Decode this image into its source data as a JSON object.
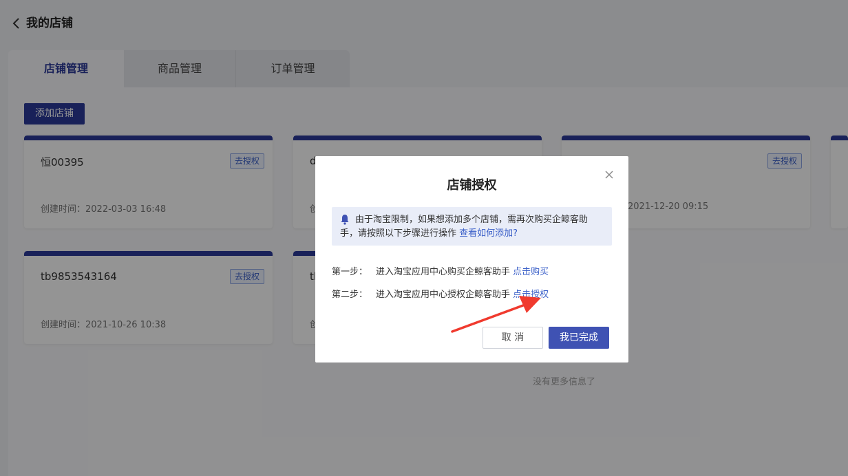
{
  "header": {
    "title": "我的店铺"
  },
  "tabs": [
    {
      "label": "店铺管理",
      "active": true
    },
    {
      "label": "商品管理"
    },
    {
      "label": "订单管理"
    }
  ],
  "toolbar": {
    "add_store_label": "添加店铺"
  },
  "stores": [
    {
      "name": "恒00395",
      "badge": "去授权",
      "created": "创建时间：2022-03-03 16:48"
    },
    {
      "name": "d",
      "badge": "",
      "created": "创"
    },
    {
      "name": "",
      "badge": "去授权",
      "created": "2021-12-20 09:15"
    },
    {
      "name": "tb9853543164",
      "badge": "去授权",
      "created": "创建时间：2021-10-26 10:38"
    },
    {
      "name": "tl",
      "badge": "",
      "created": "创"
    }
  ],
  "footer": {
    "no_more": "没有更多信息了"
  },
  "modal": {
    "title": "店铺授权",
    "notice_text": "由于淘宝限制，如果想添加多个店铺，需再次购买企鲸客助手，请按照以下步骤进行操作",
    "notice_link": "查看如何添加?",
    "step1_prefix": "第一步：",
    "step1_text": "进入淘宝应用中心购买企鲸客助手",
    "step1_link": "点击购买",
    "step2_prefix": "第二步：",
    "step2_text": "进入淘宝应用中心授权企鲸客助手",
    "step2_link": "点击授权",
    "cancel_label": "取 消",
    "done_label": "我已完成"
  },
  "colors": {
    "primary": "#2b3a99",
    "link": "#3a5fc8",
    "annotation_arrow": "#f03a2e"
  }
}
